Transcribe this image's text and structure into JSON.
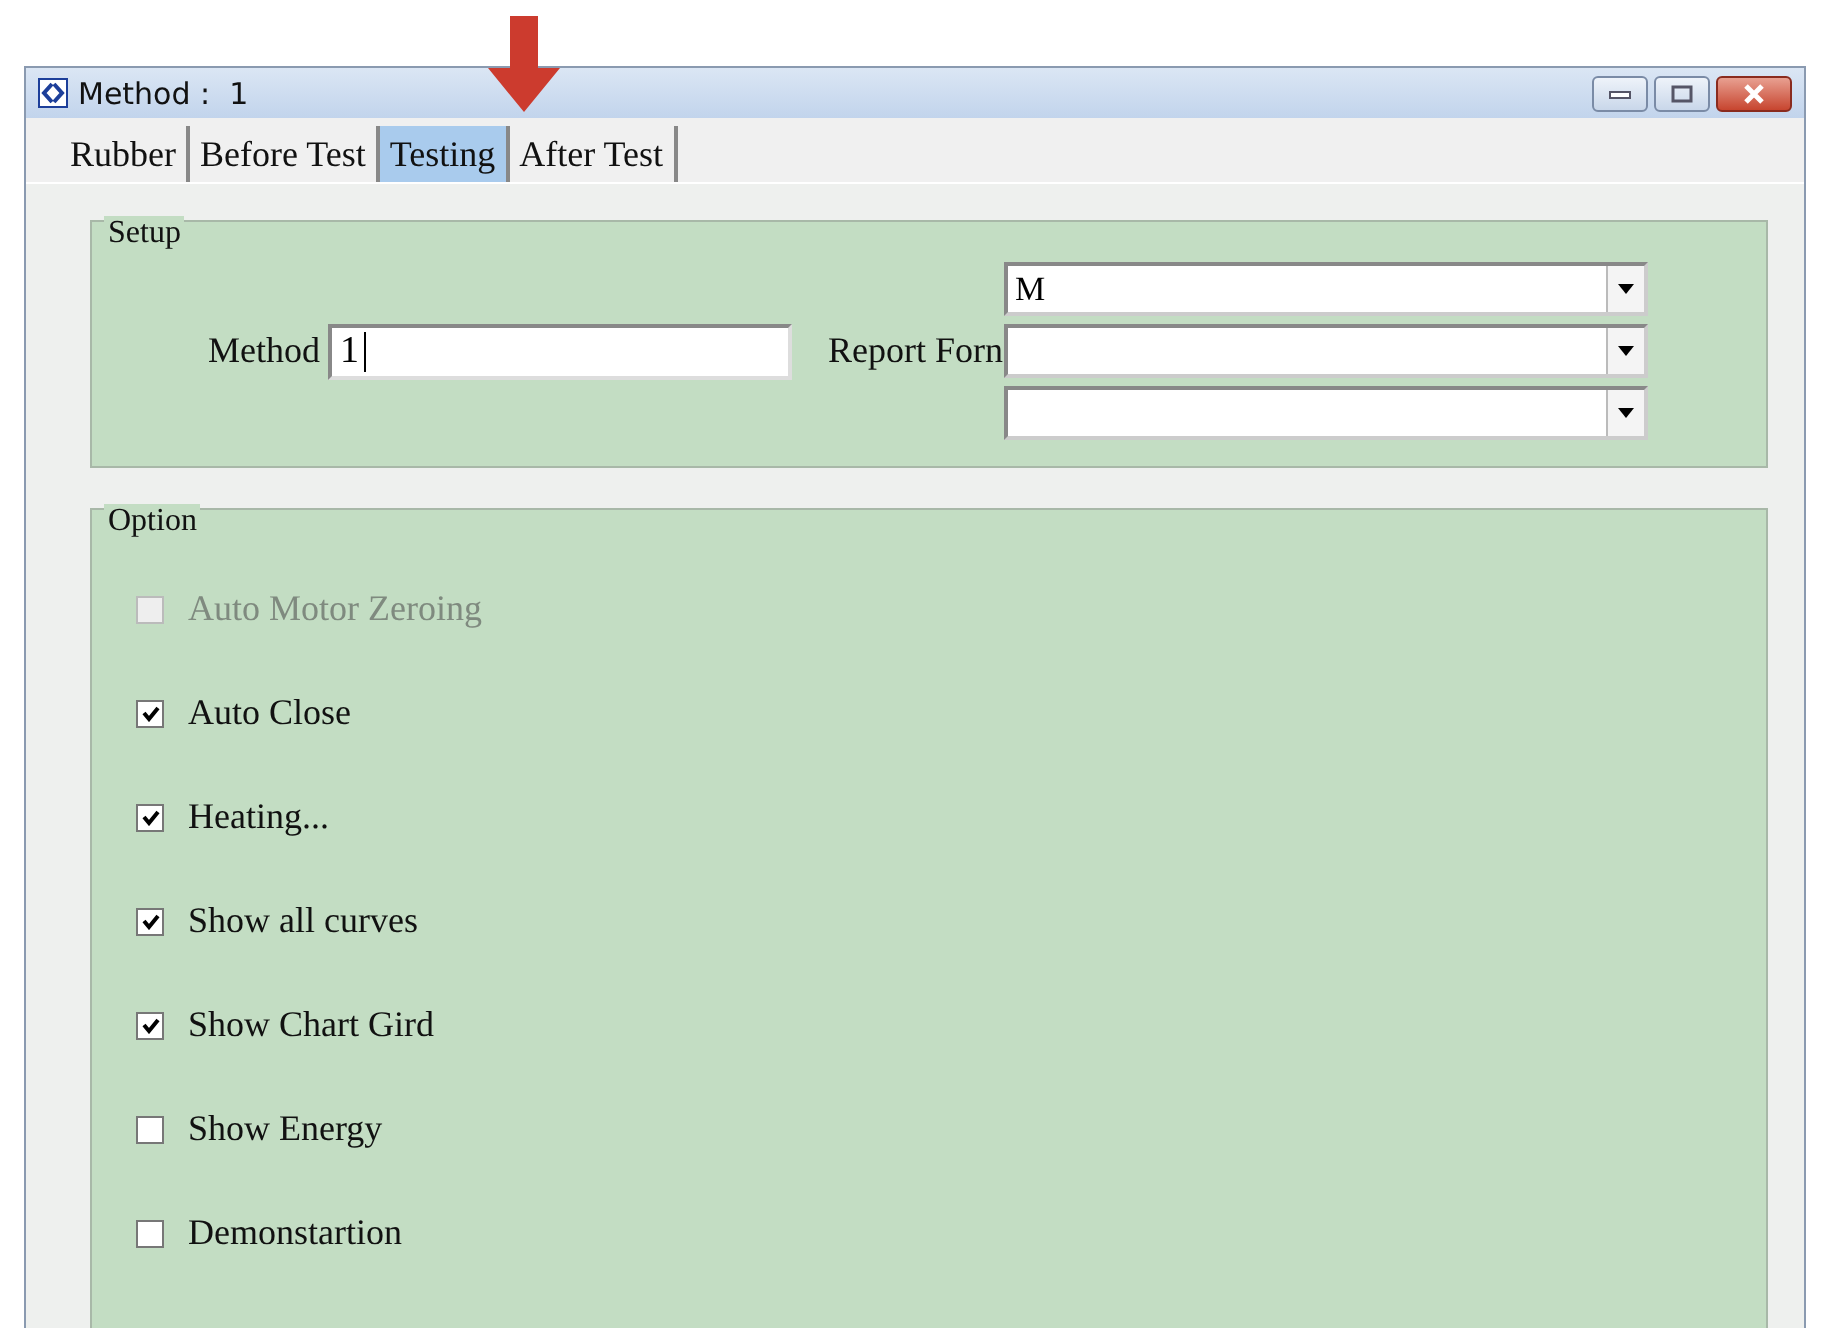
{
  "window": {
    "title": "Method :  1"
  },
  "tabs": [
    {
      "label": "Rubber",
      "selected": false
    },
    {
      "label": "Before Test",
      "selected": false
    },
    {
      "label": "Testing",
      "selected": true
    },
    {
      "label": "After Test",
      "selected": false
    }
  ],
  "setup": {
    "title": "Setup",
    "method_label": "Method",
    "method_value": "1",
    "report_label": "Report Forn",
    "combos": [
      {
        "kind": "dropdown",
        "value": "M"
      },
      {
        "kind": "dropdown"
      },
      {
        "kind": "dropdown"
      }
    ]
  },
  "option": {
    "title": "Option",
    "items": [
      {
        "kind": "checkbox",
        "label": "Auto Motor Zeroing",
        "checked": false,
        "disabled": true
      },
      {
        "kind": "checkbox",
        "label": "Auto Close",
        "checked": true,
        "disabled": false
      },
      {
        "kind": "checkbox",
        "label": "Heating...",
        "checked": true,
        "disabled": false
      },
      {
        "kind": "checkbox",
        "label": "Show all curves",
        "checked": true,
        "disabled": false
      },
      {
        "kind": "checkbox",
        "label": "Show Chart Gird",
        "checked": true,
        "disabled": false
      },
      {
        "kind": "checkbox",
        "label": "Show Energy",
        "checked": false,
        "disabled": false
      },
      {
        "kind": "checkbox",
        "label": "Demonstartion",
        "checked": false,
        "disabled": false
      }
    ]
  }
}
